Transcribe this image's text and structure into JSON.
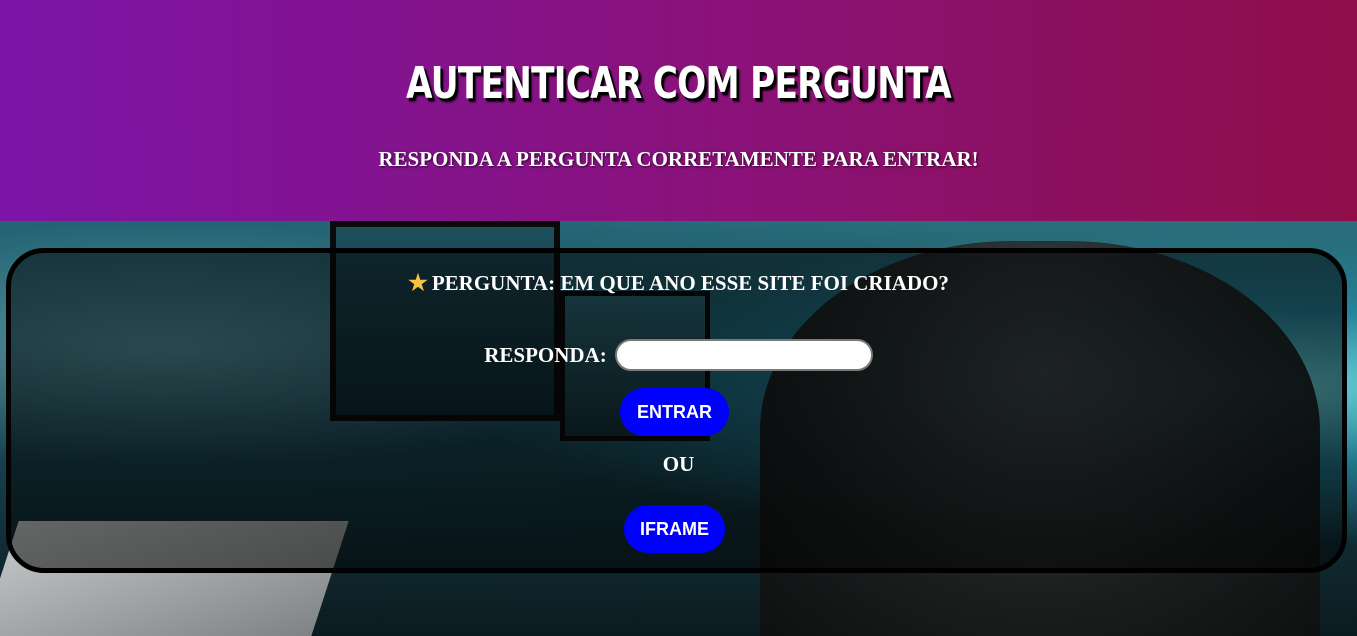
{
  "header": {
    "title": "AUTENTICAR COM PERGUNTA",
    "subtitle": "RESPONDA A PERGUNTA CORRETAMENTE PARA ENTRAR!"
  },
  "question": {
    "icon": "star-icon",
    "icon_glyph": "★",
    "text": "PERGUNTA: EM QUE ANO ESSE SITE FOI CRIADO?"
  },
  "answer": {
    "label": "RESPONDA:",
    "value": "",
    "placeholder": ""
  },
  "buttons": {
    "enter_label": "ENTRAR",
    "or_text": "OU",
    "iframe_label": "IFRAME"
  },
  "colors": {
    "header_gradient_start": "#7c14a8",
    "header_gradient_end": "#8f0e4a",
    "button_bg": "#0000ff",
    "star": "#f6c244"
  }
}
